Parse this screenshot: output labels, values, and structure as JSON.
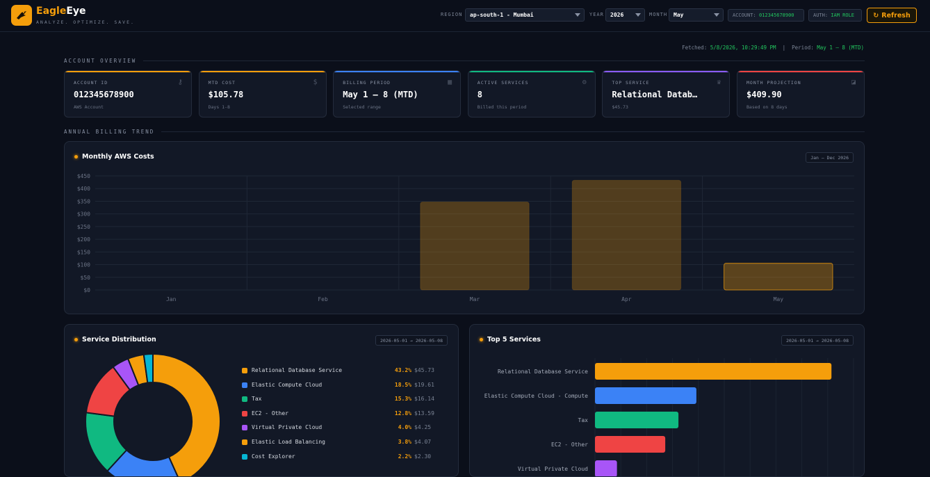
{
  "app": {
    "brand_first": "Eagle",
    "brand_second": "Eye",
    "tagline": "ANALYZE. OPTIMIZE. SAVE."
  },
  "controls": {
    "region_label": "REGION",
    "region_value": "ap-south-1 - Mumbai",
    "year_label": "YEAR",
    "year_value": "2026",
    "month_label": "MONTH",
    "month_value": "May",
    "account_label": "ACCOUNT:",
    "account_value": "012345678900",
    "auth_label": "AUTH:",
    "auth_value": "IAM ROLE",
    "refresh_label": "Refresh",
    "refresh_icon": "refresh-icon"
  },
  "fetched": {
    "fetched_label": "Fetched:",
    "fetched_value": "5/8/2026, 10:29:49 PM",
    "separator": "|",
    "period_label": "Period:",
    "period_value": "May 1 – 8 (MTD)"
  },
  "sections": {
    "overview": "ACCOUNT OVERVIEW",
    "trend": "ANNUAL BILLING TREND"
  },
  "cards": [
    {
      "label": "ACCOUNT ID",
      "value": "012345678900",
      "sub": "AWS Account",
      "color": "#f59e0b",
      "icon": "key-icon"
    },
    {
      "label": "MTD COST",
      "value": "$105.78",
      "sub": "Days 1-8",
      "color": "#f59e0b",
      "icon": "money-bag-icon"
    },
    {
      "label": "BILLING PERIOD",
      "value": "May 1 – 8 (MTD)",
      "sub": "Selected range",
      "color": "#3b82f6",
      "icon": "calendar-icon"
    },
    {
      "label": "ACTIVE SERVICES",
      "value": "8",
      "sub": "Billed this period",
      "color": "#10b981",
      "icon": "gear-icon"
    },
    {
      "label": "TOP SERVICE",
      "value": "Relational Datab…",
      "sub": "$45.73",
      "color": "#8b5cf6",
      "icon": "trophy-icon"
    },
    {
      "label": "MONTH PROJECTION",
      "value": "$409.90",
      "sub": "Based on 8 days",
      "color": "#ef4444",
      "icon": "trend-chart-icon"
    }
  ],
  "panels": {
    "monthly_title": "Monthly AWS Costs",
    "monthly_badge": "Jan – Dec 2026",
    "distribution_title": "Service Distribution",
    "distribution_badge": "2026-05-01 → 2026-05-08",
    "top5_title": "Top 5 Services",
    "top5_badge": "2026-05-01 → 2026-05-08"
  },
  "chart_data": [
    {
      "type": "bar",
      "title": "Monthly AWS Costs",
      "categories": [
        "Jan",
        "Feb",
        "Mar",
        "Apr",
        "May"
      ],
      "values": [
        0,
        0,
        347,
        433,
        105.78
      ],
      "ylim": [
        0,
        450
      ],
      "yticks": [
        "$0",
        "$50",
        "$100",
        "$150",
        "$200",
        "$250",
        "$300",
        "$350",
        "$400",
        "$450"
      ],
      "grid": true,
      "color": "#f59e0b"
    },
    {
      "type": "pie",
      "title": "Service Distribution",
      "categories": [
        "Relational Database Service",
        "Elastic Compute Cloud",
        "Tax",
        "EC2 - Other",
        "Virtual Private Cloud",
        "Elastic Load Balancing",
        "Cost Explorer"
      ],
      "values": [
        45.73,
        19.61,
        16.14,
        13.59,
        4.25,
        4.07,
        2.3
      ],
      "percents": [
        "43.2%",
        "18.5%",
        "15.3%",
        "12.8%",
        "4.0%",
        "3.8%",
        "2.2%"
      ],
      "value_labels": [
        "$45.73",
        "$19.61",
        "$16.14",
        "$13.59",
        "$4.25",
        "$4.07",
        "$2.30"
      ],
      "colors": [
        "#f59e0b",
        "#3b82f6",
        "#10b981",
        "#ef4444",
        "#a855f7",
        "#f59e0b",
        "#06b6d4"
      ]
    },
    {
      "type": "bar",
      "orientation": "horizontal",
      "title": "Top 5 Services",
      "categories": [
        "Relational Database Service",
        "Elastic Compute Cloud - Compute",
        "Tax",
        "EC2 - Other",
        "Virtual Private Cloud"
      ],
      "values": [
        45.73,
        19.61,
        16.14,
        13.59,
        4.25
      ],
      "xlim": [
        0,
        50
      ],
      "colors": [
        "#f59e0b",
        "#3b82f6",
        "#10b981",
        "#ef4444",
        "#a855f7"
      ]
    }
  ]
}
